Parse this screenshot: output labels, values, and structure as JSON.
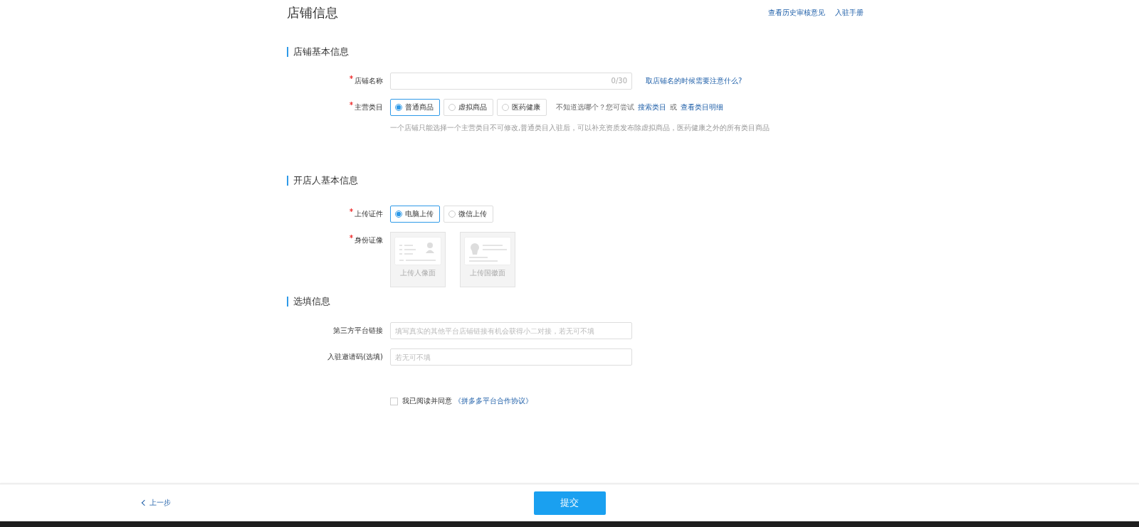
{
  "header": {
    "title": "店铺信息",
    "links": [
      "查看历史审核意见",
      "入驻手册"
    ]
  },
  "sections": [
    {
      "title": "店铺基本信息",
      "fields": [
        {
          "kind": "text",
          "label": "店铺名称",
          "required": true,
          "counter": "0/30",
          "help_link": "取店铺名的时候需要注意什么?"
        },
        {
          "kind": "radio",
          "label": "主营类目",
          "required": true,
          "options": [
            {
              "label": "普通商品",
              "selected": true
            },
            {
              "label": "虚拟商品",
              "selected": false
            },
            {
              "label": "医药健康",
              "selected": false
            }
          ],
          "tip": "不知道选哪个？您可尝试",
          "tip_links": [
            "搜索类目",
            "查看类目明细"
          ],
          "tip_joiner": "或",
          "note": "一个店铺只能选择一个主营类目不可修改,普通类目入驻后，可以补充资质发布除虚拟商品，医药健康之外的所有类目商品"
        }
      ]
    },
    {
      "title": "开店人基本信息",
      "fields": [
        {
          "kind": "radio",
          "label": "上传证件",
          "required": true,
          "options": [
            {
              "label": "电脑上传",
              "selected": true
            },
            {
              "label": "微信上传",
              "selected": false
            }
          ]
        },
        {
          "kind": "upload",
          "label": "身份证像",
          "required": true,
          "cards": [
            {
              "kind": "portrait",
              "caption": "上传人像面"
            },
            {
              "kind": "emblem",
              "caption": "上传国徽面"
            }
          ]
        }
      ]
    },
    {
      "title": "选填信息",
      "fields": [
        {
          "kind": "text",
          "label": "第三方平台链接",
          "required": false,
          "placeholder": "填写真实的其他平台店铺链接有机会获得小二对接，若无可不填"
        },
        {
          "kind": "text",
          "label": "入驻邀请码(选填)",
          "required": false,
          "placeholder": "若无可不填"
        }
      ]
    }
  ],
  "agreement": {
    "checked": false,
    "text": "我已阅读并同意",
    "link": "《拼多多平台合作协议》"
  },
  "footer": {
    "back": "上一步",
    "submit": "提交"
  }
}
